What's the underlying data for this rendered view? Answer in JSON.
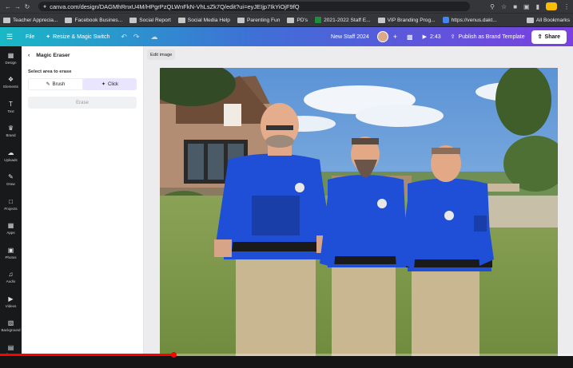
{
  "browser": {
    "url": "canva.com/design/DAGMhRnxU4M/HPgrPzQLWnFkN-VhLsZk7Q/edit?ui=eyJEIjp7IkYiOjF9fQ",
    "bookmarks": [
      "Teacher Apprecia...",
      "Facebook Busines...",
      "Social Report",
      "Social Media Help",
      "Parenting Fun",
      "PD's",
      "2021-2022 Staff E...",
      "VIP Branding Prog...",
      "https://venus.dakt..."
    ],
    "all_bookmarks": "All Bookmarks"
  },
  "toolbar": {
    "file": "File",
    "resize": "Resize & Magic Switch",
    "doc_title": "New Staff 2024",
    "duration": "2:43",
    "publish": "Publish as Brand Template",
    "share": "Share"
  },
  "rail": {
    "items": [
      "Design",
      "Elements",
      "Text",
      "Brand",
      "Uploads",
      "Draw",
      "Projects",
      "Apps",
      "Photos",
      "Audio",
      "Videos",
      "Background",
      "Bulk create"
    ]
  },
  "panel": {
    "title": "Magic Eraser",
    "select_label": "Select area to erase",
    "brush": "Brush",
    "click": "Click",
    "erase": "Erase"
  },
  "canvas": {
    "edit_image": "Edit image"
  },
  "colors": {
    "accent": "#7b3fe0",
    "rail_bg": "#18191b",
    "uniform_blue": "#1f4fd6",
    "progress": "#ff0000"
  },
  "video": {
    "progress_fraction": 0.304
  }
}
